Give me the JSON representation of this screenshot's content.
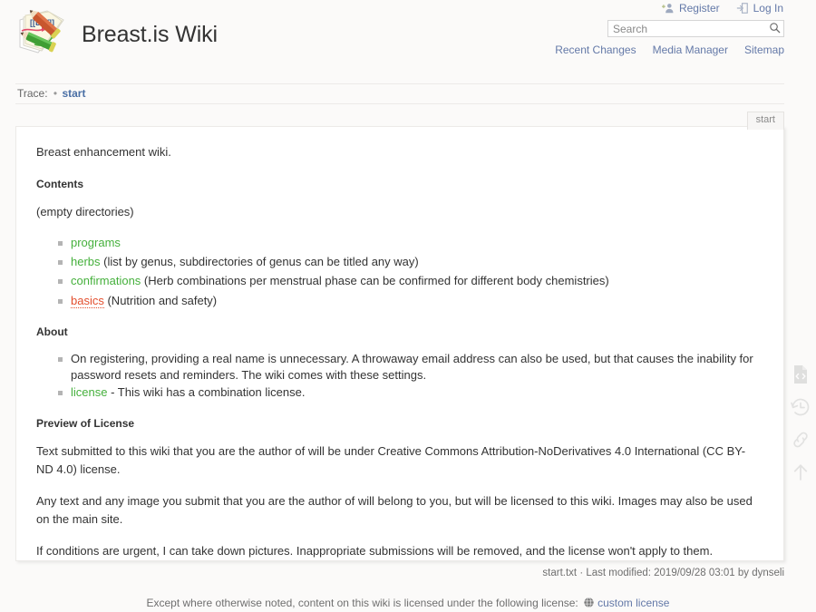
{
  "site": {
    "title": "Breast.is Wiki",
    "logo_icon": "dokuwiki-logo"
  },
  "user_tools": [
    {
      "label": "Register",
      "icon": "user-add-icon"
    },
    {
      "label": "Log In",
      "icon": "login-icon"
    }
  ],
  "search": {
    "placeholder": "Search",
    "value": "",
    "icon": "search-icon"
  },
  "site_tools": [
    {
      "label": "Recent Changes"
    },
    {
      "label": "Media Manager"
    },
    {
      "label": "Sitemap"
    }
  ],
  "breadcrumb": {
    "label": "Trace:",
    "separator": "•",
    "items": [
      {
        "label": "start"
      }
    ]
  },
  "page_tab": {
    "label": "start"
  },
  "content": {
    "intro": "Breast enhancement wiki.",
    "contents_heading": "Contents",
    "empty_note": "(empty directories)",
    "contents_items": [
      {
        "link": "programs",
        "link_class": "exists",
        "rest": ""
      },
      {
        "link": "herbs",
        "link_class": "exists",
        "rest": " (list by genus, subdirectories of genus can be titled any way)"
      },
      {
        "link": "confirmations",
        "link_class": "exists",
        "rest": " (Herb combinations per menstrual phase can be confirmed for different body chemistries)"
      },
      {
        "link": "basics",
        "link_class": "missing",
        "rest": " (Nutrition and safety)"
      }
    ],
    "about_heading": "About",
    "about_items": [
      {
        "link": "",
        "link_class": "",
        "rest": "On registering, providing a real name is unnecessary. A throwaway email address can also be used, but that causes the inability for password resets and reminders. The wiki comes with these settings."
      },
      {
        "link": "license",
        "link_class": "exists",
        "rest": " - This wiki has a combination license."
      }
    ],
    "preview_heading": "Preview of License",
    "preview_paragraphs": [
      "Text submitted to this wiki that you are the author of will be under Creative Commons Attribution-NoDerivatives 4.0 International (CC BY-ND 4.0) license.",
      "Any text and any image you submit that you are the author of will belong to you, but will be licensed to this wiki. Images may also be used on the main site.",
      "If conditions are urgent, I can take down pictures. Inappropriate submissions will be removed, and the license won't apply to them."
    ]
  },
  "page_tools": [
    {
      "name": "show-pagesource-icon"
    },
    {
      "name": "old-revisions-icon"
    },
    {
      "name": "backlinks-icon"
    },
    {
      "name": "back-to-top-icon"
    }
  ],
  "docinfo": {
    "text": "start.txt · Last modified: 2019/09/28 03:01 by dynseli"
  },
  "footer_license": {
    "prefix": "Except where otherwise noted, content on this wiki is licensed under the following license:",
    "link": "custom license",
    "icon": "globe-icon"
  },
  "colors": {
    "link_blue": "#6479a8",
    "breadcrumb_link": "#4a6fa5",
    "wikilink_exists": "#45b03c",
    "wikilink_missing": "#e34f2e",
    "page_bg": "#fbfaf9",
    "content_bg": "#ffffff"
  }
}
